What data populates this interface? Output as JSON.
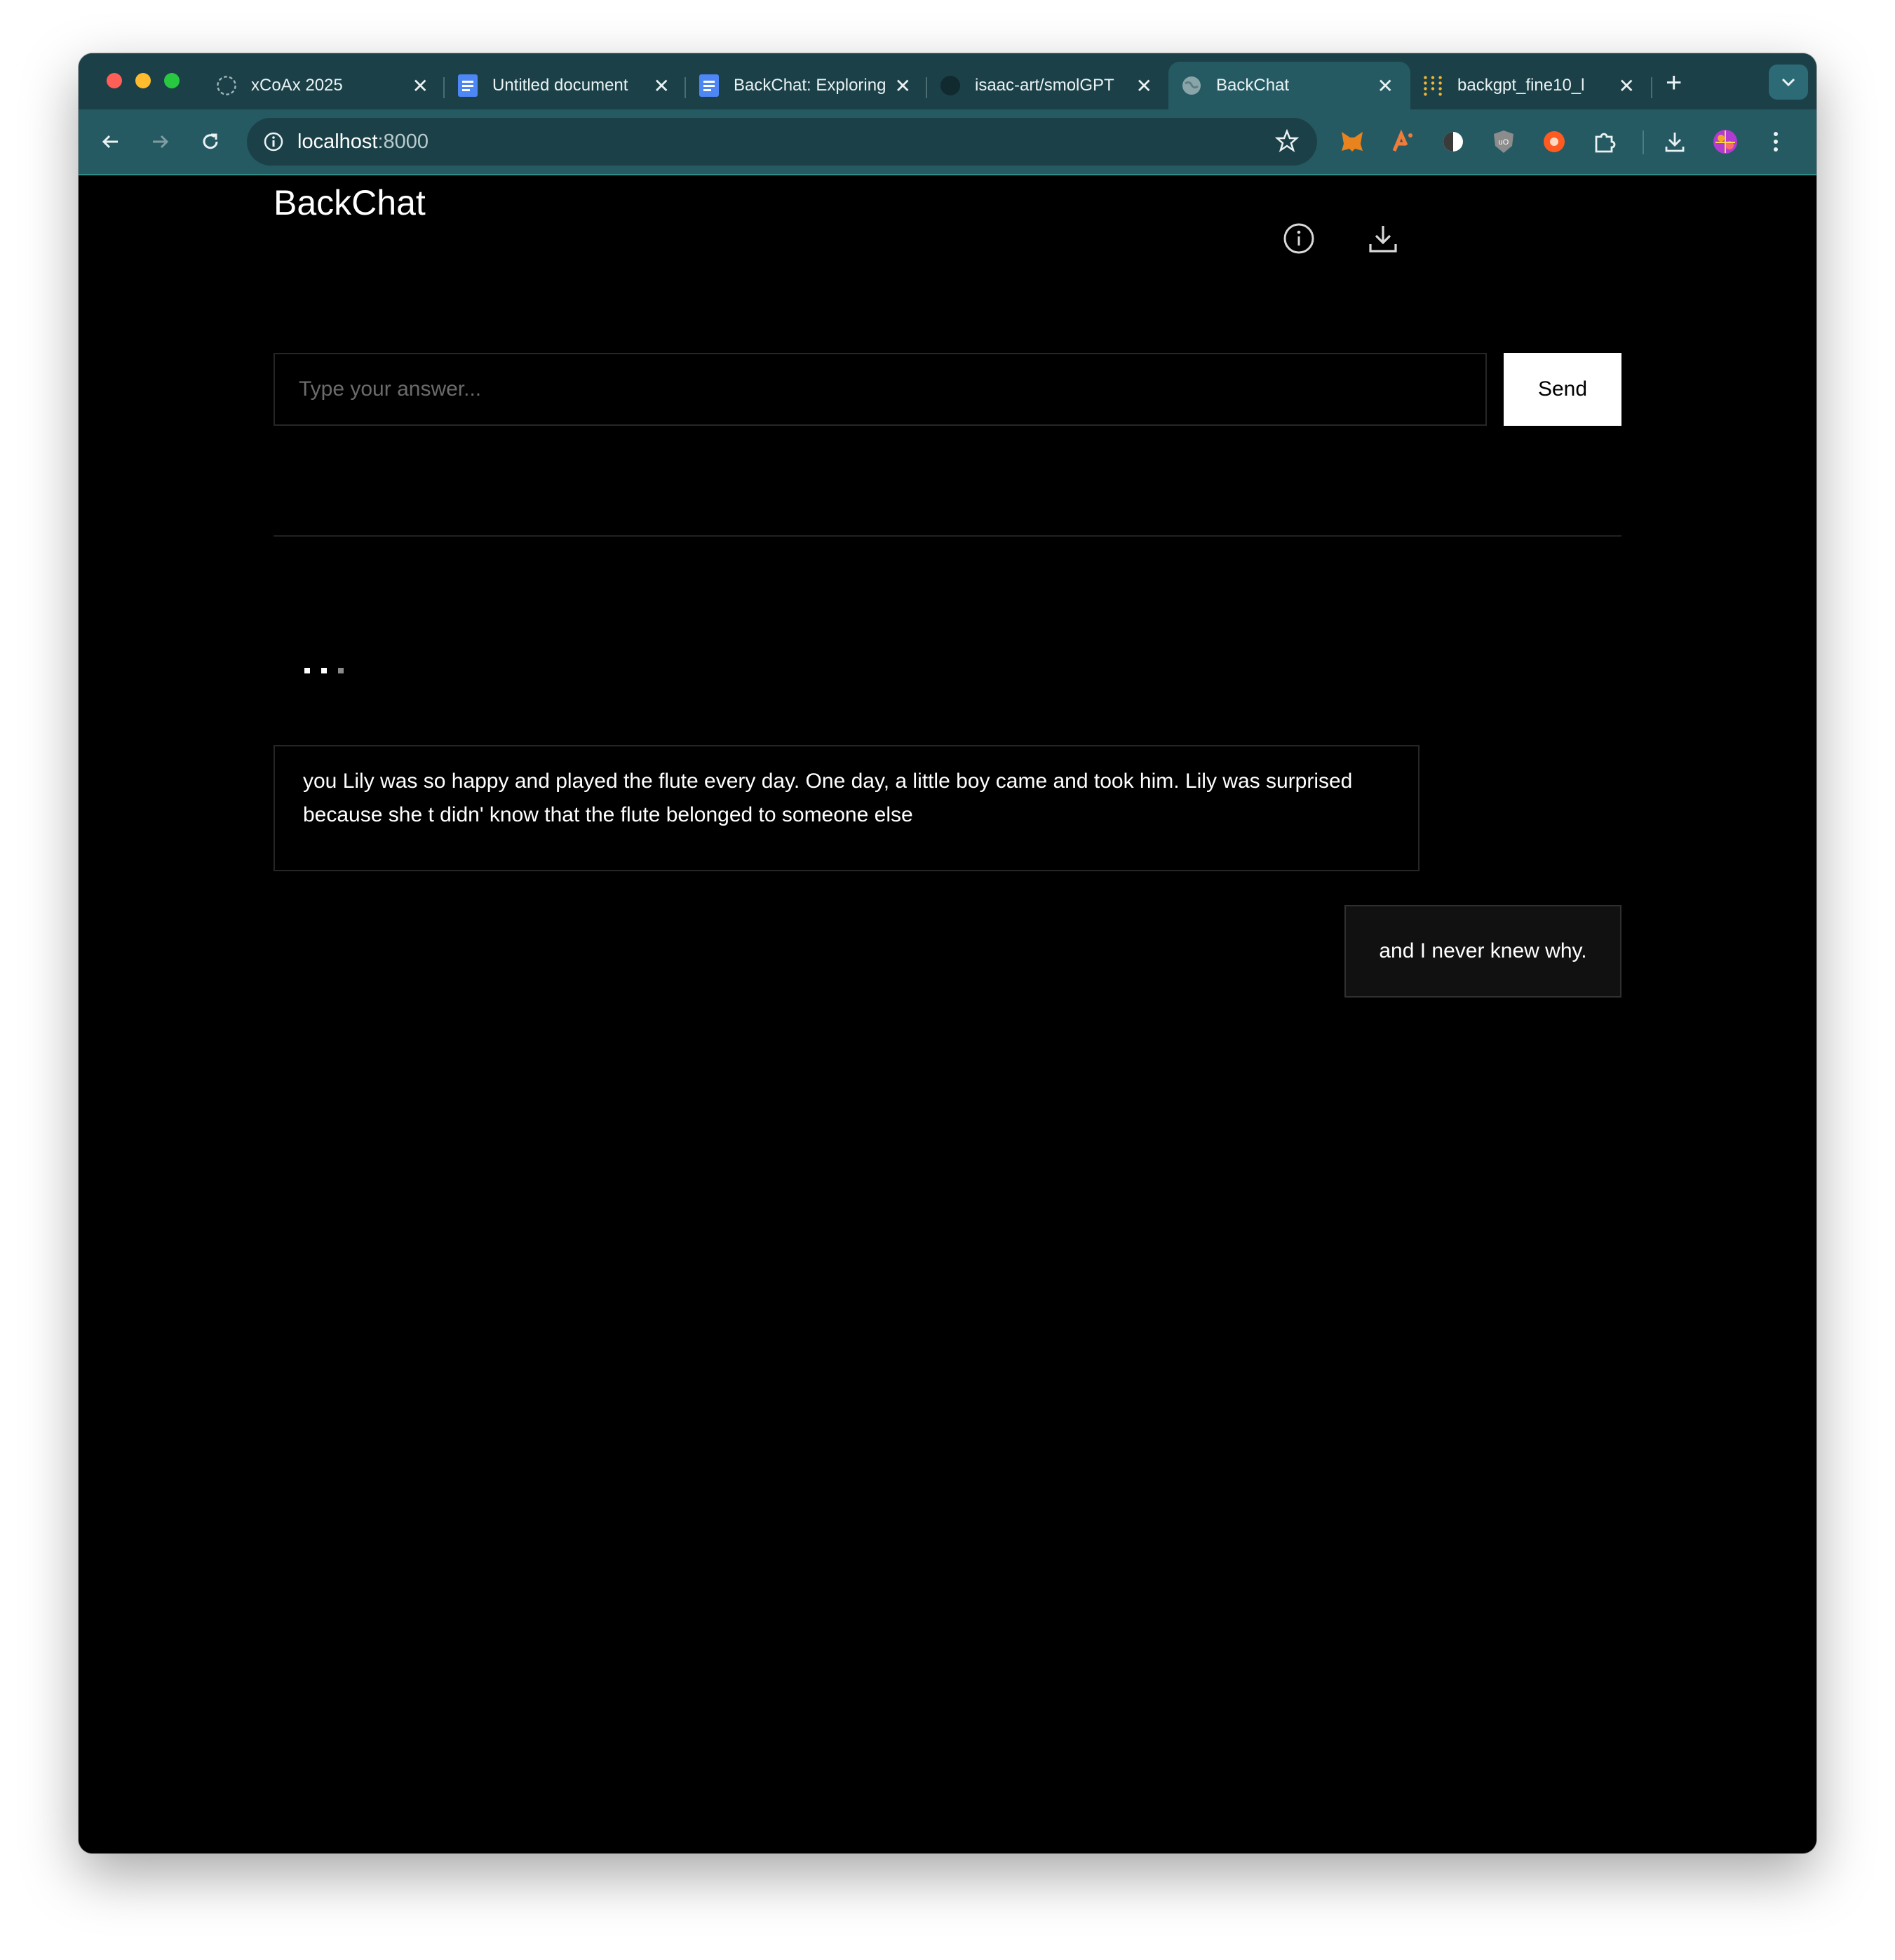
{
  "browser": {
    "tabs": [
      {
        "title": "xCoAx 2025",
        "icon": "loading-spinner-icon",
        "active": false
      },
      {
        "title": "Untitled document",
        "icon": "google-docs-icon",
        "active": false
      },
      {
        "title": "BackChat: Exploring",
        "icon": "google-docs-icon",
        "active": false
      },
      {
        "title": "isaac-art/smolGPT",
        "icon": "github-icon",
        "active": false
      },
      {
        "title": "BackChat",
        "icon": "globe-icon",
        "active": true
      },
      {
        "title": "backgpt_fine10_l",
        "icon": "dots-grid-icon",
        "active": false
      }
    ],
    "new_tab_label": "+",
    "close_label": "✕",
    "url": {
      "host": "localhost",
      "port": ":8000"
    },
    "colors": {
      "tabstrip": "#1b4048",
      "toolbar": "#265a63",
      "omnibox": "#1b4048"
    }
  },
  "app": {
    "title": "BackChat",
    "header_icons": [
      "info-icon",
      "download-icon"
    ],
    "input": {
      "placeholder": "Type your answer...",
      "value": ""
    },
    "send_label": "Send",
    "typing_indicator": "...",
    "messages": [
      {
        "role": "ai",
        "text": "you Lily was so happy and played the flute every day. One day, a little boy came and took him. Lily was surprised because she t didn' know that the flute belonged to someone else"
      },
      {
        "role": "user",
        "text": "and I never knew why."
      }
    ]
  }
}
